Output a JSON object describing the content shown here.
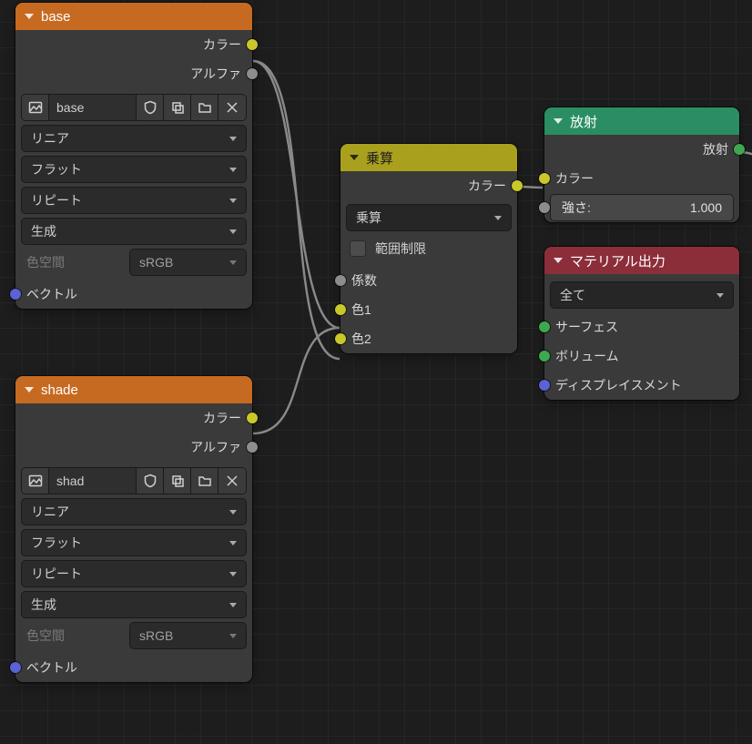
{
  "nodes": {
    "base": {
      "title": "base",
      "out_color": "カラー",
      "out_alpha": "アルファ",
      "image_name": "base",
      "interpolation": "リニア",
      "projection": "フラット",
      "extension": "リピート",
      "source": "生成",
      "colorspace_label": "色空間",
      "colorspace_value": "sRGB",
      "in_vector": "ベクトル"
    },
    "shade": {
      "title": "shade",
      "out_color": "カラー",
      "out_alpha": "アルファ",
      "image_name": "shad",
      "interpolation": "リニア",
      "projection": "フラット",
      "extension": "リピート",
      "source": "生成",
      "colorspace_label": "色空間",
      "colorspace_value": "sRGB",
      "in_vector": "ベクトル"
    },
    "mix": {
      "title": "乗算",
      "out_color": "カラー",
      "blend_mode": "乗算",
      "clamp_label": "範囲制限",
      "in_fac": "係数",
      "in_color1": "色1",
      "in_color2": "色2"
    },
    "emission": {
      "title": "放射",
      "out_emission": "放射",
      "in_color": "カラー",
      "strength_label": "強さ:",
      "strength_value": "1.000"
    },
    "output": {
      "title": "マテリアル出力",
      "target": "全て",
      "in_surface": "サーフェス",
      "in_volume": "ボリューム",
      "in_displacement": "ディスプレイスメント"
    }
  }
}
